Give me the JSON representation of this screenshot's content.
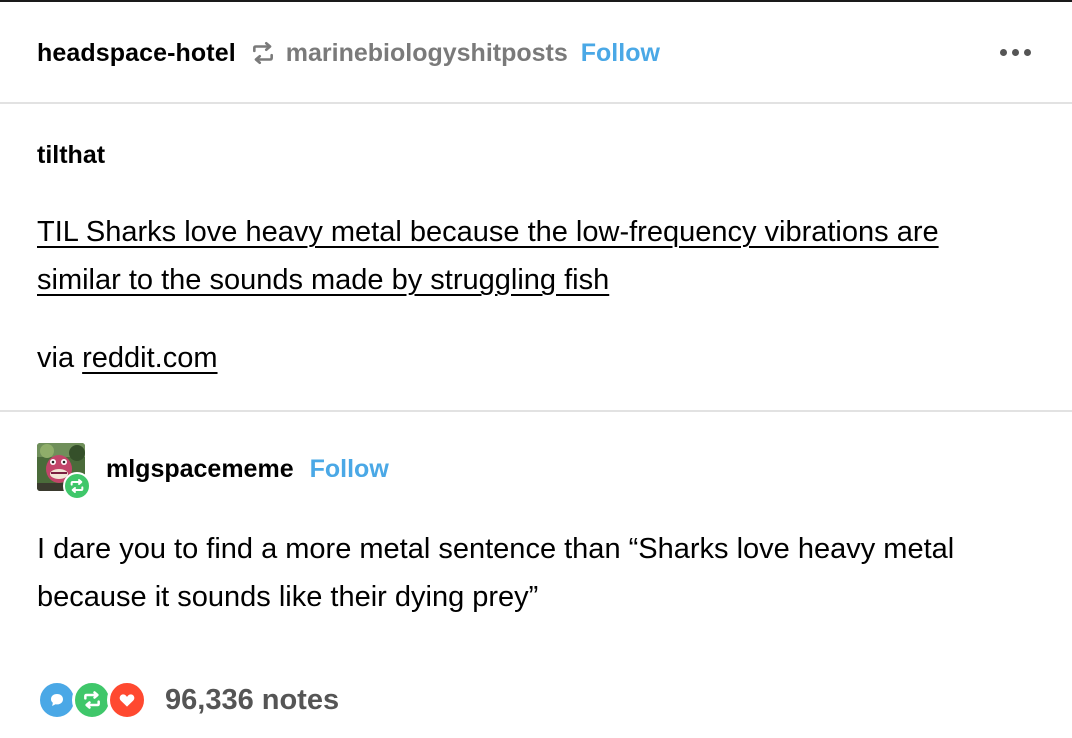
{
  "post": {
    "reblogger": "headspace-hotel",
    "source": "marinebiologyshitposts",
    "follow_label": "Follow"
  },
  "original": {
    "author": "tilthat",
    "link_text": "TIL Sharks love heavy metal because the low-frequency vibrations are similar to the sounds made by struggling fish",
    "via_prefix": "via",
    "via_link": "reddit.com"
  },
  "reply": {
    "author": "mlgspacememe",
    "follow_label": "Follow",
    "body": "I dare you to find a more metal sentence than “Sharks love heavy metal because it sounds like their dying prey”"
  },
  "footer": {
    "notes": "96,336 notes"
  },
  "icons": {
    "reblog": "reblog-icon",
    "more": "more-options-icon",
    "comment": "comment-icon",
    "like": "heart-icon"
  },
  "colors": {
    "follow": "#4aa8e6",
    "source_text": "#7a7a7a",
    "comment_bubble": "#4aa8e6",
    "reblog_bubble": "#3fc76a",
    "like_bubble": "#ff4930"
  }
}
